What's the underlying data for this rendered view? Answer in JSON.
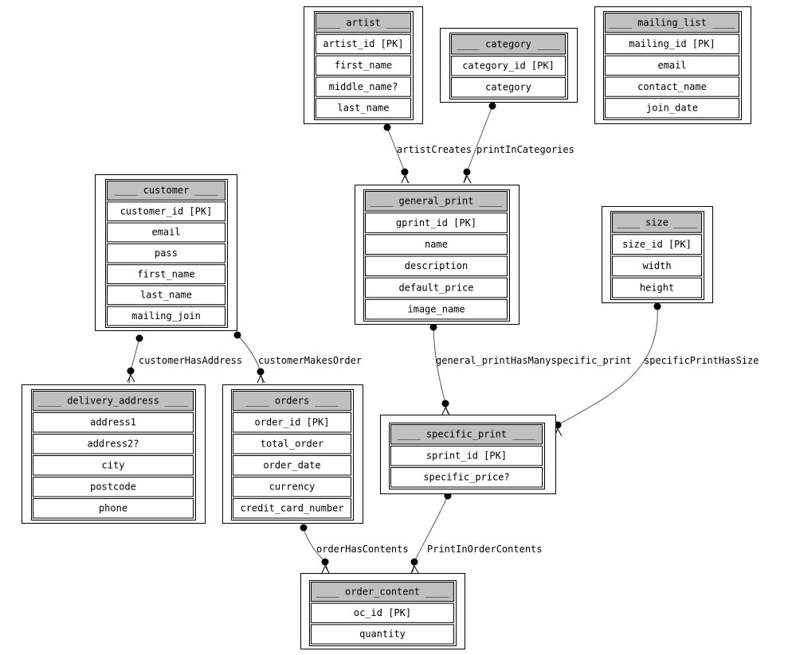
{
  "colors": {
    "header_fill": "#c0c0c0",
    "row_fill": "#ffffff",
    "stroke": "#000000",
    "edge": "#555555"
  },
  "tables": [
    {
      "id": "artist",
      "header": "____ artist ____",
      "fields": [
        "artist_id [PK]",
        "first_name",
        "middle_name?",
        "last_name"
      ]
    },
    {
      "id": "category",
      "header": "____ category ____",
      "fields": [
        "category_id [PK]",
        "category"
      ]
    },
    {
      "id": "mailing_list",
      "header": "____ mailing_list ____",
      "fields": [
        "mailing_id [PK]",
        "email",
        "contact_name",
        "join_date"
      ]
    },
    {
      "id": "customer",
      "header": "____ customer ____",
      "fields": [
        "customer_id [PK]",
        "email",
        "pass",
        "first_name",
        "last_name",
        "mailing_join"
      ]
    },
    {
      "id": "general_print",
      "header": "____ general_print ____",
      "fields": [
        "gprint_id [PK]",
        "name",
        "description",
        "default_price",
        "image_name"
      ]
    },
    {
      "id": "size",
      "header": "____ size ____",
      "fields": [
        "size_id [PK]",
        "width",
        "height"
      ]
    },
    {
      "id": "delivery_address",
      "header": "____ delivery_address ____",
      "fields": [
        "address1",
        "address2?",
        "city",
        "postcode",
        "phone"
      ]
    },
    {
      "id": "orders",
      "header": "____ orders ____",
      "fields": [
        "order_id [PK]",
        "total_order",
        "order_date",
        "currency",
        "credit_card_number"
      ]
    },
    {
      "id": "specific_print",
      "header": "____ specific_print ____",
      "fields": [
        "sprint_id [PK]",
        "specific_price?"
      ]
    },
    {
      "id": "order_content",
      "header": "____ order_content ____",
      "fields": [
        "oc_id [PK]",
        "quantity"
      ]
    }
  ],
  "relationships": [
    {
      "label": "artistCreates",
      "from": "artist",
      "to": "general_print"
    },
    {
      "label": "printInCategories",
      "from": "category",
      "to": "general_print"
    },
    {
      "label": "customerHasAddress",
      "from": "customer",
      "to": "delivery_address"
    },
    {
      "label": "customerMakesOrder",
      "from": "customer",
      "to": "orders"
    },
    {
      "label": "general_printHasManyspecific_print",
      "from": "general_print",
      "to": "specific_print"
    },
    {
      "label": "specificPrintHasSize",
      "from": "size",
      "to": "specific_print"
    },
    {
      "label": "orderHasContents",
      "from": "orders",
      "to": "order_content"
    },
    {
      "label": "PrintInOrderContents",
      "from": "specific_print",
      "to": "order_content"
    }
  ]
}
